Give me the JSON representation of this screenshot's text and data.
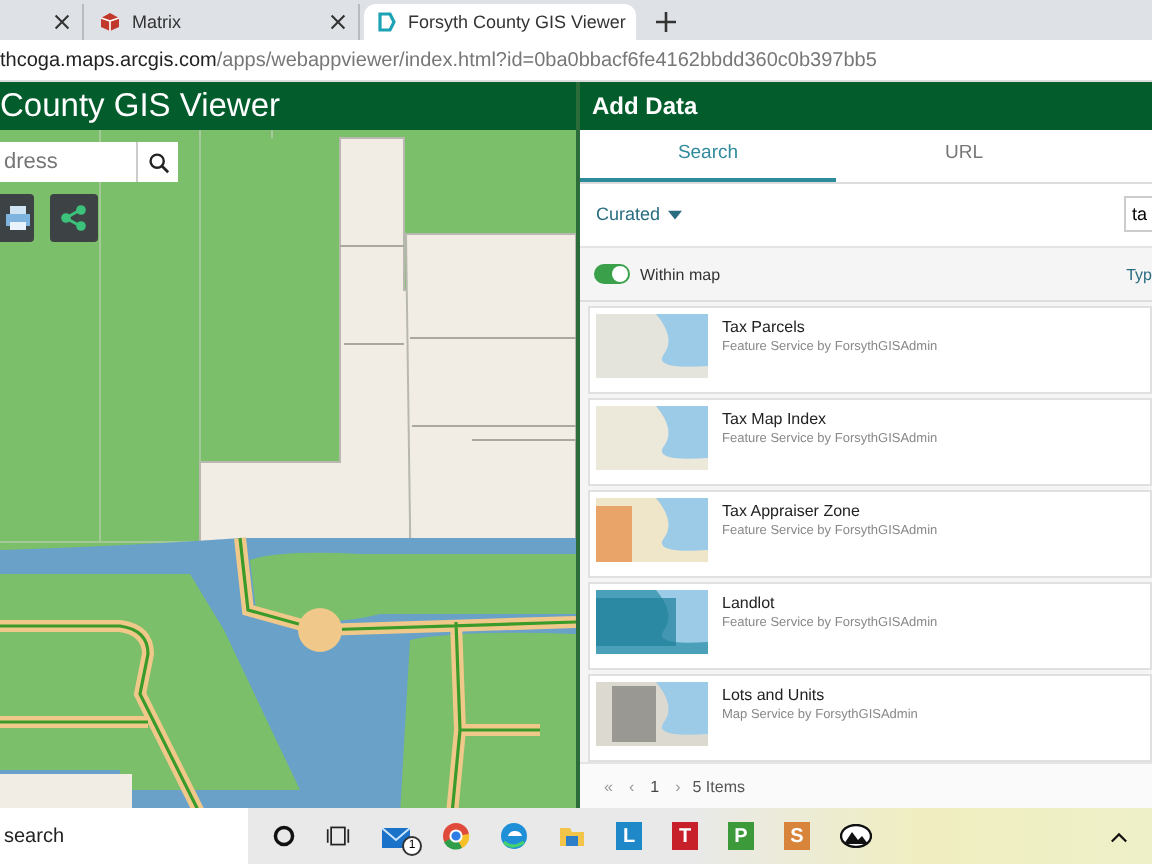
{
  "browser": {
    "tabs": [
      {
        "title": "Matrix",
        "selected": false,
        "kind": "cube"
      },
      {
        "title": "Forsyth County GIS Viewer",
        "selected": true,
        "kind": "viewer"
      }
    ],
    "address": {
      "domain": "thcoga.maps.arcgis.com",
      "path": "/apps/webappviewer/index.html?id=0ba0bbacf6fe4162bbdd360c0b397bb5"
    }
  },
  "app": {
    "title": "County GIS Viewer",
    "search": {
      "placeholder": "dress"
    }
  },
  "panel": {
    "title": "Add Data",
    "tabs": [
      {
        "label": "Search",
        "selected": true
      },
      {
        "label": "URL",
        "selected": false
      }
    ],
    "filter": "Curated",
    "query": "ta",
    "within_map": {
      "label": "Within map",
      "on": true
    },
    "type_label": "Typ",
    "items": [
      {
        "title": "Tax Parcels",
        "subtitle": "Feature Service by ForsythGISAdmin"
      },
      {
        "title": "Tax Map Index",
        "subtitle": "Feature Service by ForsythGISAdmin"
      },
      {
        "title": "Tax Appraiser Zone",
        "subtitle": "Feature Service by ForsythGISAdmin"
      },
      {
        "title": "Landlot",
        "subtitle": "Feature Service by ForsythGISAdmin"
      },
      {
        "title": "Lots and Units",
        "subtitle": "Map Service by ForsythGISAdmin"
      }
    ],
    "pager": {
      "first": "«",
      "prev": "‹",
      "page": "1",
      "next": "›",
      "count": "5 Items"
    }
  },
  "taskbar": {
    "search": "search",
    "apps": [
      {
        "kind": "cortana"
      },
      {
        "kind": "taskview"
      },
      {
        "kind": "mail",
        "badge": "1"
      },
      {
        "kind": "chrome"
      },
      {
        "kind": "edge"
      },
      {
        "kind": "folder"
      },
      {
        "kind": "letter",
        "letter": "L",
        "color": "#1e88c8"
      },
      {
        "kind": "letter",
        "letter": "T",
        "color": "#c8202a"
      },
      {
        "kind": "letter",
        "letter": "P",
        "color": "#3d9a3a"
      },
      {
        "kind": "letter",
        "letter": "S",
        "color": "#d8843a"
      },
      {
        "kind": "photo"
      }
    ]
  }
}
